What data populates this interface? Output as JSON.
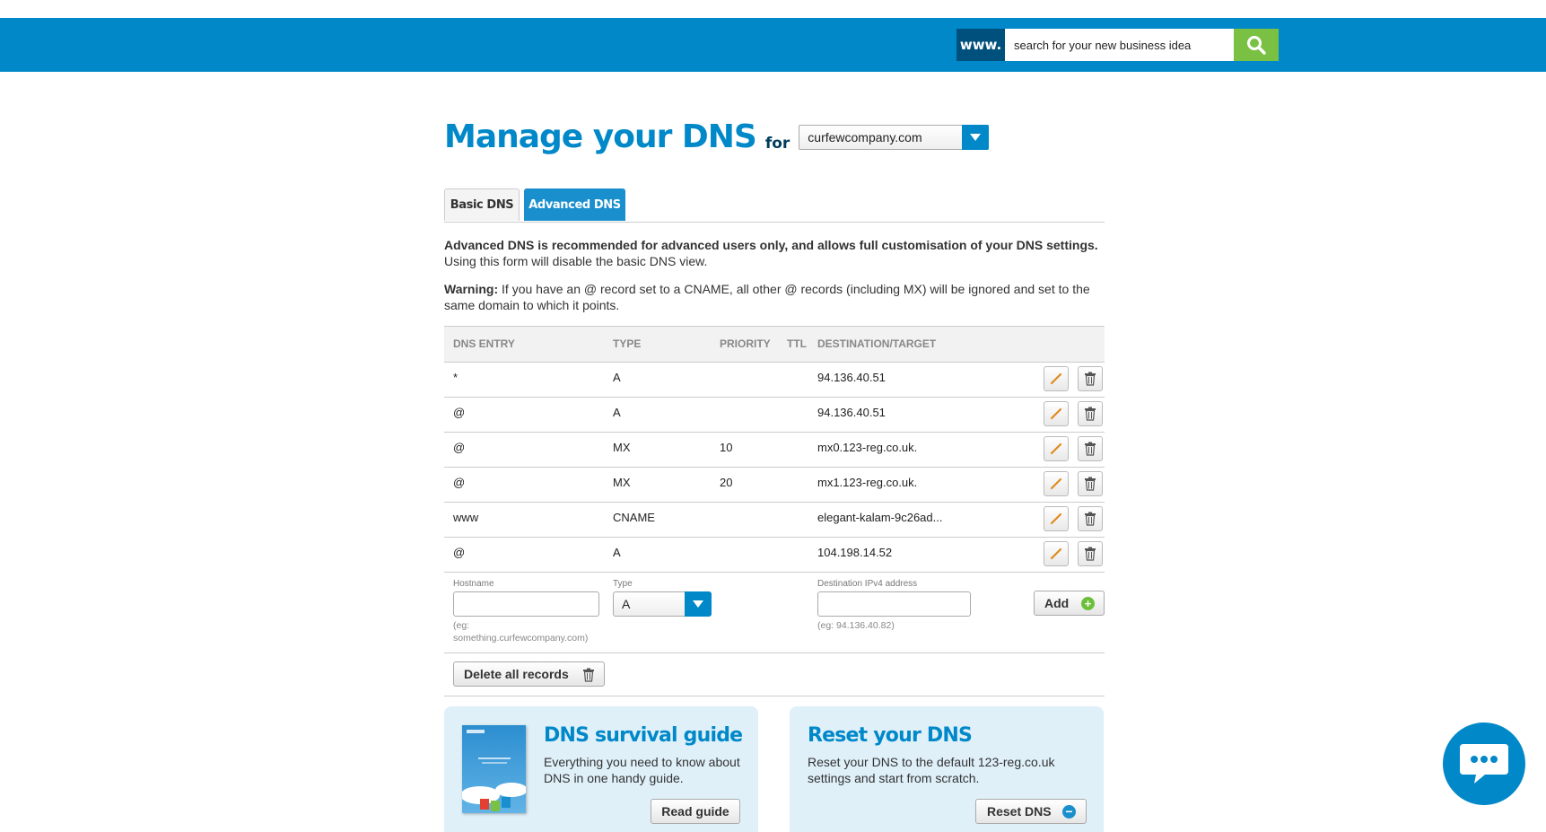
{
  "header": {
    "www_label": "www.",
    "search_placeholder": "search for your new business idea"
  },
  "page": {
    "title": "Manage your DNS",
    "for_label": "for",
    "domain_selected": "curfewcompany.com"
  },
  "tabs": [
    {
      "label": "Basic DNS",
      "active": false
    },
    {
      "label": "Advanced DNS",
      "active": true
    }
  ],
  "intro": {
    "bold": "Advanced DNS is recommended for advanced users only, and allows full customisation of your DNS settings.",
    "text": "Using this form will disable the basic DNS view."
  },
  "warning": {
    "label": "Warning:",
    "text": " If you have an @ record set to a CNAME, all other @ records (including MX) will be ignored and set to the same domain to which it points."
  },
  "table": {
    "headers": [
      "DNS ENTRY",
      "TYPE",
      "PRIORITY",
      "TTL",
      "DESTINATION/TARGET"
    ],
    "rows": [
      {
        "entry": "*",
        "type": "A",
        "priority": "",
        "ttl": "",
        "destination": "94.136.40.51"
      },
      {
        "entry": "@",
        "type": "A",
        "priority": "",
        "ttl": "",
        "destination": "94.136.40.51"
      },
      {
        "entry": "@",
        "type": "MX",
        "priority": "10",
        "ttl": "",
        "destination": "mx0.123-reg.co.uk."
      },
      {
        "entry": "@",
        "type": "MX",
        "priority": "20",
        "ttl": "",
        "destination": "mx1.123-reg.co.uk."
      },
      {
        "entry": "www",
        "type": "CNAME",
        "priority": "",
        "ttl": "",
        "destination": "elegant-kalam-9c26ad..."
      },
      {
        "entry": "@",
        "type": "A",
        "priority": "",
        "ttl": "",
        "destination": "104.198.14.52"
      }
    ]
  },
  "add_form": {
    "hostname_label": "Hostname",
    "hostname_value": "",
    "hostname_hint_1": "(eg:",
    "hostname_hint_2": "something.curfewcompany.com)",
    "type_label": "Type",
    "type_selected": "A",
    "destination_label": "Destination IPv4 address",
    "destination_value": "",
    "destination_hint": "(eg: 94.136.40.82)",
    "add_button": "Add"
  },
  "delete_all_button": "Delete all records",
  "cards": {
    "guide": {
      "title": "DNS survival guide",
      "text": "Everything you need to know about DNS in one handy guide.",
      "button": "Read guide"
    },
    "reset": {
      "title": "Reset your DNS",
      "text": "Reset your DNS to the default 123-reg.co.uk settings and start from scratch.",
      "button": "Reset DNS"
    }
  },
  "colors": {
    "brand_blue": "#0088c9",
    "dark_blue": "#00507e",
    "search_green": "#7ac143",
    "card_bg": "#dff0f9"
  },
  "icons": [
    "search-icon",
    "dropdown-arrow-icon",
    "edit-pencil-icon",
    "trash-icon",
    "plus-circle-icon",
    "minus-circle-icon",
    "chat-icon"
  ]
}
